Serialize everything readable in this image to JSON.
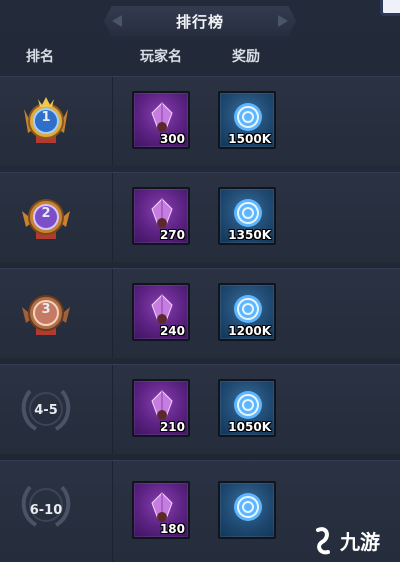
{
  "header": {
    "title": "排行榜"
  },
  "columns": {
    "rank": "排名",
    "player": "玩家名",
    "reward": "奖励"
  },
  "rows": [
    {
      "rank": "1",
      "badge": "gold-medal-1",
      "gem_qty": "300",
      "orb_qty": "1500K"
    },
    {
      "rank": "2",
      "badge": "purple-medal-2",
      "gem_qty": "270",
      "orb_qty": "1350K"
    },
    {
      "rank": "3",
      "badge": "bronze-medal-3",
      "gem_qty": "240",
      "orb_qty": "1200K"
    },
    {
      "rank": "4-5",
      "badge": "laurel-wreath",
      "gem_qty": "210",
      "orb_qty": "1050K"
    },
    {
      "rank": "6-10",
      "badge": "laurel-wreath",
      "gem_qty": "180",
      "orb_qty": ""
    }
  ],
  "icons": {
    "gem": "purple-crystal-icon",
    "orb": "blue-orb-icon"
  },
  "colors": {
    "background": "#1f2735",
    "gem_slot": "#5b2282",
    "orb_slot": "#1f4a72",
    "gold": "#e2a93b"
  },
  "watermark": {
    "text": "九游"
  }
}
